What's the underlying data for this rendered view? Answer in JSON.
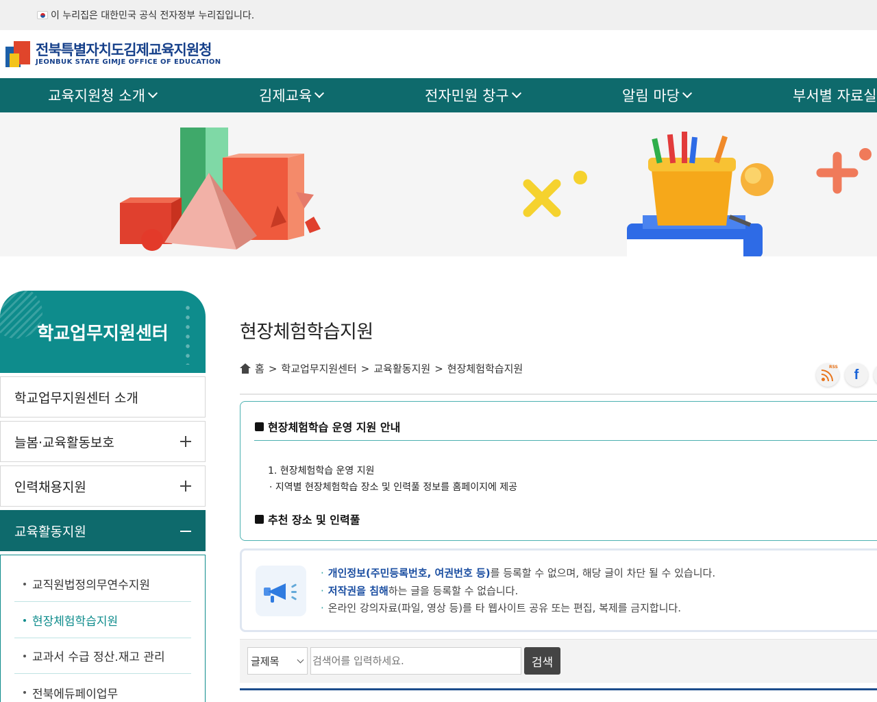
{
  "gov_bar": {
    "text": "이 누리집은 대한민국 공식 전자정부 누리집입니다."
  },
  "logo": {
    "korean": "전북특별자치도김제교육지원청",
    "english": "JEONBUK STATE GIMJE OFFICE OF EDUCATION"
  },
  "nav": {
    "items": [
      {
        "label": "교육지원청 소개"
      },
      {
        "label": "김제교육"
      },
      {
        "label": "전자민원 창구"
      },
      {
        "label": "알림 마당"
      },
      {
        "label": "부서별 자료실"
      }
    ]
  },
  "sidebar": {
    "title": "학교업무지원센터",
    "items": [
      {
        "label": "학교업무지원센터 소개",
        "expandable": false
      },
      {
        "label": "늘봄·교육활동보호",
        "expandable": true
      },
      {
        "label": "인력채용지원",
        "expandable": true
      },
      {
        "label": "교육활동지원",
        "active": true
      }
    ],
    "sub_items": [
      {
        "label": "교직원법정의무연수지원"
      },
      {
        "label": "현장체험학습지원",
        "current": true
      },
      {
        "label": "교과서 수급 정산.재고 관리"
      },
      {
        "label": "전북에듀페이업무"
      }
    ]
  },
  "main": {
    "title": "현장체험학습지원",
    "breadcrumb": [
      "홈",
      "학교업무지원센터",
      "교육활동지원",
      "현장체험학습지원"
    ],
    "breadcrumb_sep": ">",
    "social": {
      "rss": "RSS",
      "facebook": "f"
    },
    "section1_title": "현장체험학습 운영 지원 안내",
    "section1_item": "1. 현장체험학습 운영 지원",
    "section1_detail": "· 지역별 현장체험학습 장소 및 인력풀 정보를 홈페이지에 제공",
    "section2_title": "추천 장소 및 인력풀"
  },
  "notice": {
    "line1_bold": "개인정보(주민등록번호, 여권번호 등)",
    "line1_rest": "를 등록할 수 없으며, 해당 글이 차단 될 수 있습니다.",
    "line2_bold": "저작권을 침해",
    "line2_rest": "하는 글을 등록할 수 없습니다.",
    "line3": "온라인 강의자료(파일, 영상 등)를 타 웹사이트 공유 또는 편집, 복제를 금지합니다.",
    "bullet": "·"
  },
  "search": {
    "select_value": "글제목",
    "placeholder": "검색어를 입력하세요.",
    "button_label": "검색"
  },
  "colors": {
    "nav": "#0e6a6c",
    "sidebar_head": "#0e8c8c",
    "logo": "#16408a",
    "notice_bold": "#1b4ea1"
  }
}
